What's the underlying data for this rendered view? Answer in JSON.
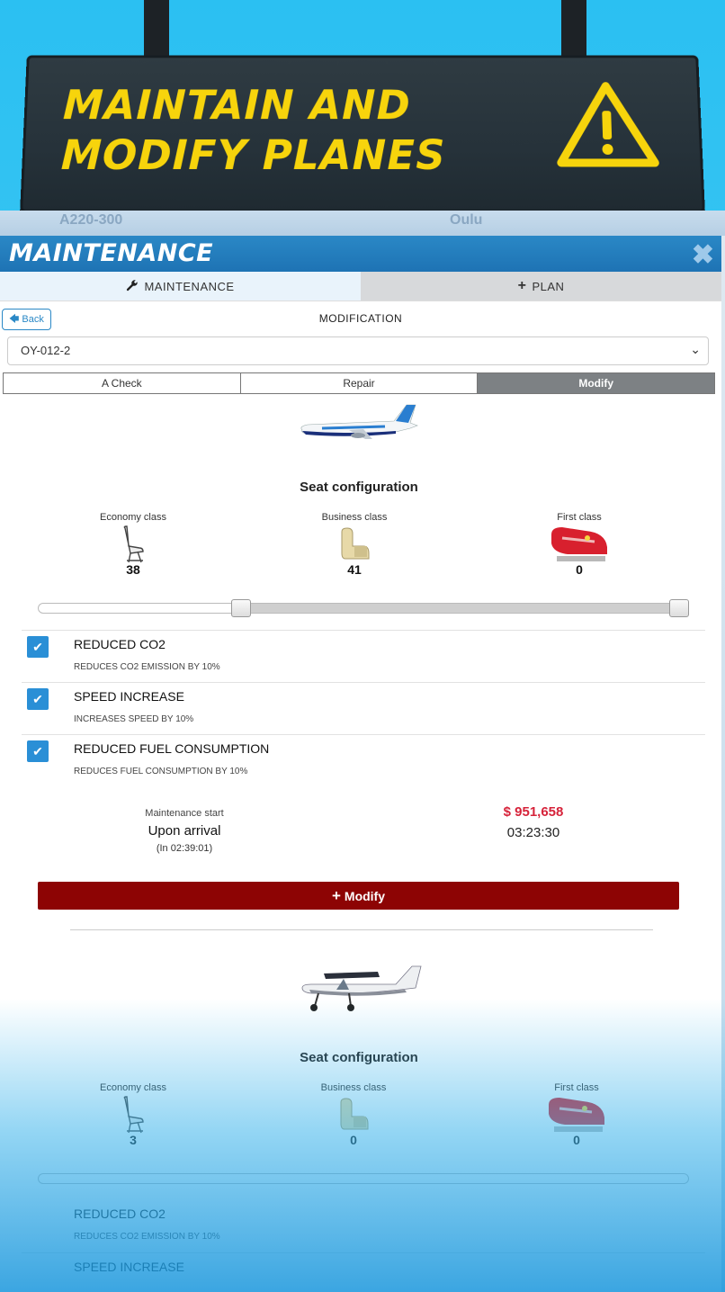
{
  "banner": {
    "title": "MAINTAIN AND\nMODIFY PLANES",
    "warning_icon": "warning-triangle-icon",
    "accent": "#f7d40c"
  },
  "map_strip": {
    "left_text": "A220-300",
    "right_text": "Oulu"
  },
  "panel": {
    "title": "MAINTENANCE",
    "close_icon": "close-icon",
    "tabs": [
      {
        "label": "MAINTENANCE",
        "icon": "wrench-icon"
      },
      {
        "label": "PLAN",
        "icon": "plus-icon"
      }
    ],
    "back_label": "Back",
    "subtitle": "MODIFICATION",
    "aircraft_select": "OY-012-2",
    "segments": [
      "A Check",
      "Repair",
      "Modify"
    ],
    "active_segment": "Modify"
  },
  "plane1": {
    "seat_title": "Seat configuration",
    "classes": [
      {
        "label": "Economy class",
        "count": "38"
      },
      {
        "label": "Business class",
        "count": "41"
      },
      {
        "label": "First class",
        "count": "0"
      }
    ],
    "slider_position": 0.31,
    "mods": [
      {
        "name": "REDUCED CO2",
        "desc": "REDUCES CO2 EMISSION BY 10%",
        "checked": true
      },
      {
        "name": "SPEED INCREASE",
        "desc": "INCREASES SPEED BY 10%",
        "checked": true
      },
      {
        "name": "REDUCED FUEL CONSUMPTION",
        "desc": "REDUCES FUEL CONSUMPTION BY 10%",
        "checked": true
      }
    ],
    "maintenance_start_label": "Maintenance start",
    "maintenance_start_value": "Upon arrival",
    "maintenance_start_eta": "(In 02:39:01)",
    "price": "$ 951,658",
    "duration": "03:23:30",
    "modify_button": "Modify"
  },
  "plane2": {
    "seat_title": "Seat configuration",
    "classes": [
      {
        "label": "Economy class",
        "count": "3"
      },
      {
        "label": "Business class",
        "count": "0"
      },
      {
        "label": "First class",
        "count": "0"
      }
    ],
    "mods": [
      {
        "name": "REDUCED CO2",
        "desc": "REDUCES CO2 EMISSION BY 10%"
      },
      {
        "name": "SPEED INCREASE"
      }
    ]
  },
  "colors": {
    "header_blue": "#2a88c6",
    "modify_button": "#8d0404",
    "price_red": "#d6233a",
    "checkbox_blue": "#2a8fd6"
  }
}
